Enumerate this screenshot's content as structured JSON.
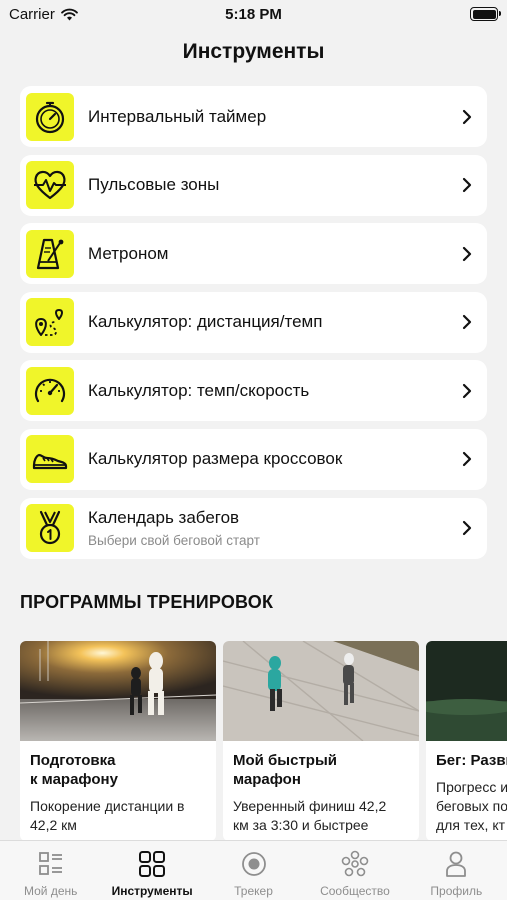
{
  "status_bar": {
    "carrier": "Carrier",
    "time": "5:18 PM"
  },
  "header": {
    "title": "Инструменты"
  },
  "tools": [
    {
      "label": "Интервальный таймер",
      "sub": "",
      "icon": "stopwatch-icon"
    },
    {
      "label": "Пульсовые зоны",
      "sub": "",
      "icon": "heart-pulse-icon"
    },
    {
      "label": "Метроном",
      "sub": "",
      "icon": "metronome-icon"
    },
    {
      "label": "Калькулятор: дистанция/темп",
      "sub": "",
      "icon": "route-pin-icon"
    },
    {
      "label": "Калькулятор: темп/скорость",
      "sub": "",
      "icon": "speedometer-icon"
    },
    {
      "label": "Калькулятор размера кроссовок",
      "sub": "",
      "icon": "sneaker-icon"
    },
    {
      "label": "Календарь забегов",
      "sub": "Выбери свой беговой старт",
      "icon": "medal-icon"
    }
  ],
  "programs": {
    "title": "ПРОГРАММЫ ТРЕНИРОВОК",
    "cards": [
      {
        "title": "Подготовка\nк марафону",
        "desc": "Покорение дистанции в\n42,2 км"
      },
      {
        "title": "Мой быстрый\nмарафон",
        "desc": "Уверенный финиш 42,2\nкм за 3:30 и быстрее"
      },
      {
        "title": "Бег: Разви",
        "desc": "Прогресс и\nбеговых по\nдля тех, кт"
      }
    ]
  },
  "tab_bar": [
    {
      "label": "Мой день",
      "icon": "my-day-icon",
      "active": false
    },
    {
      "label": "Инструменты",
      "icon": "grid-icon",
      "active": true
    },
    {
      "label": "Трекер",
      "icon": "record-icon",
      "active": false
    },
    {
      "label": "Сообщество",
      "icon": "community-icon",
      "active": false
    },
    {
      "label": "Профиль",
      "icon": "profile-icon",
      "active": false
    }
  ],
  "colors": {
    "accent": "#f0f52a",
    "background": "#f2f2f2",
    "card": "#ffffff",
    "muted": "#8e8e8e"
  }
}
